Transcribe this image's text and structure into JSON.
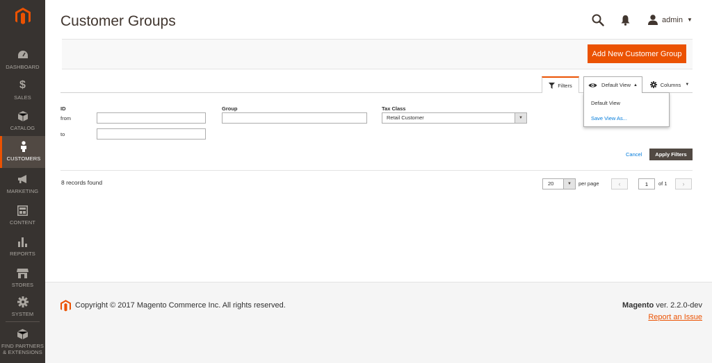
{
  "sidebar": {
    "items": [
      {
        "label": "DASHBOARD",
        "icon": "dashboard-icon"
      },
      {
        "label": "SALES",
        "icon": "dollar-icon"
      },
      {
        "label": "CATALOG",
        "icon": "box-icon"
      },
      {
        "label": "CUSTOMERS",
        "icon": "person-icon"
      },
      {
        "label": "MARKETING",
        "icon": "megaphone-icon"
      },
      {
        "label": "CONTENT",
        "icon": "layout-icon"
      },
      {
        "label": "REPORTS",
        "icon": "bar-chart-icon"
      },
      {
        "label": "STORES",
        "icon": "storefront-icon"
      },
      {
        "label": "SYSTEM",
        "icon": "gear-icon"
      },
      {
        "label_line1": "FIND PARTNERS",
        "label_line2": "& EXTENSIONS",
        "icon": "package-icon"
      }
    ]
  },
  "header": {
    "title": "Customer Groups",
    "user": "admin"
  },
  "actions": {
    "add_new": "Add New Customer Group"
  },
  "toolbar": {
    "filters": "Filters",
    "view": "Default View",
    "columns": "Columns",
    "dropdown": {
      "default_view": "Default View",
      "save_view_as": "Save View As..."
    }
  },
  "filters": {
    "id_label": "ID",
    "from_label": "from",
    "to_label": "to",
    "from_value": "",
    "to_value": "",
    "group_label": "Group",
    "group_value": "",
    "tax_class_label": "Tax Class",
    "tax_class_value": "Retail Customer",
    "cancel": "Cancel",
    "apply": "Apply Filters"
  },
  "grid": {
    "records_found": "8 records found",
    "per_page_value": "20",
    "per_page_label": "per page",
    "current_page": "1",
    "page_total": "of 1"
  },
  "footer": {
    "copyright": "Copyright © 2017 Magento Commerce Inc. All rights reserved.",
    "brand": "Magento",
    "version": "ver. 2.2.0-dev",
    "report_issue": "Report an Issue"
  },
  "colors": {
    "accent": "#eb5202",
    "sidebar_bg": "#373330",
    "link": "#007bdb"
  }
}
